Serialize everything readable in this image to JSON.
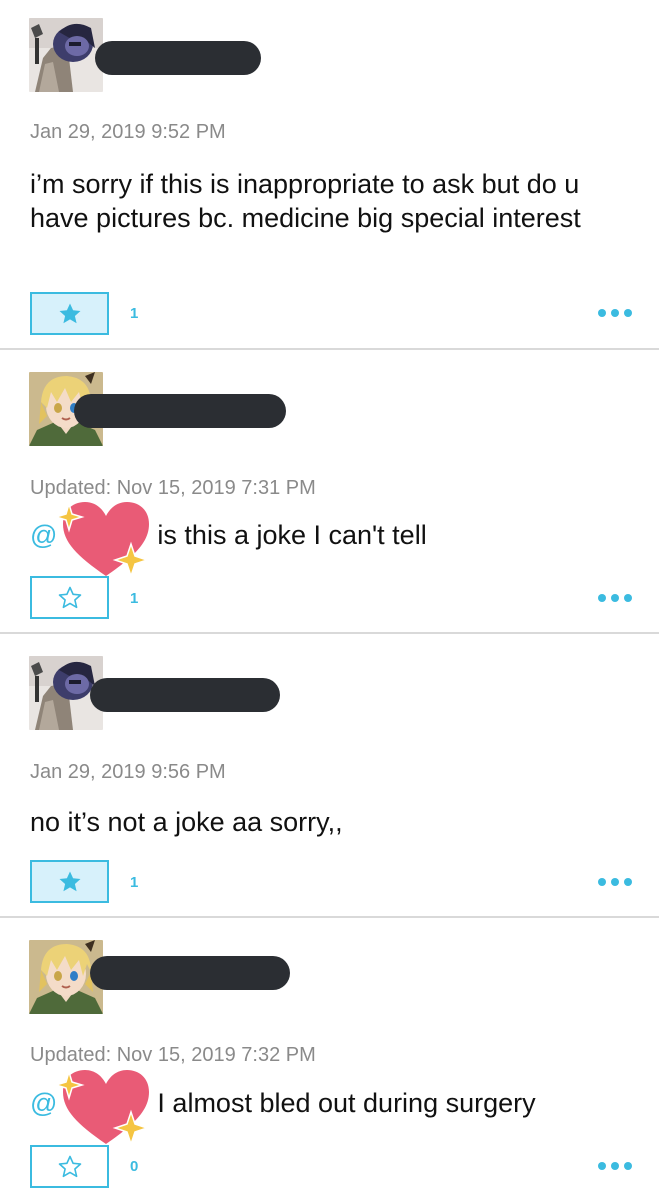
{
  "colors": {
    "accent": "#3bbbe0",
    "star_active_bg": "#d7f1fb",
    "redaction": "#2b2e33",
    "heart": "#e95b76",
    "sparkle": "#f5c542"
  },
  "comments": [
    {
      "avatar": "purple-character-avatar-icon",
      "timestamp": "Jan 29, 2019 9:52 PM",
      "text": "i’m sorry if this is inappropriate to ask but do u have pictures bc. medicine big special interest",
      "starred": true,
      "like_count": "1"
    },
    {
      "avatar": "blonde-character-avatar-icon",
      "timestamp": "Updated: Nov 15, 2019 7:31 PM",
      "mention": "@",
      "text": "is this a joke I can't tell",
      "starred": false,
      "like_count": "1"
    },
    {
      "avatar": "purple-character-avatar-icon",
      "timestamp": "Jan 29, 2019 9:56 PM",
      "text": "no it’s not a joke aa sorry,,",
      "starred": true,
      "like_count": "1"
    },
    {
      "avatar": "blonde-character-avatar-icon",
      "timestamp": "Updated: Nov 15, 2019 7:32 PM",
      "mention": "@",
      "text": "I almost bled out during surgery",
      "starred": false,
      "like_count": "0"
    }
  ]
}
